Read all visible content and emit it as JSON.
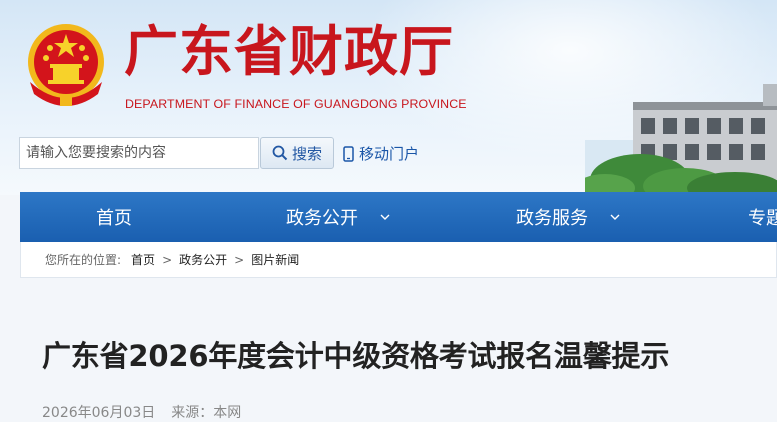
{
  "header": {
    "title_cn": "广东省财政厅",
    "title_en": "DEPARTMENT OF FINANCE OF GUANGDONG PROVINCE",
    "brand_color": "#c8161d"
  },
  "search": {
    "placeholder": "请输入您要搜索的内容",
    "button_label": "搜索",
    "mobile_label": "移动门户"
  },
  "nav": {
    "items": [
      {
        "label": "首页"
      },
      {
        "label": "政务公开"
      },
      {
        "label": "政务服务"
      },
      {
        "label": "专题"
      }
    ],
    "color": "#1f66b5"
  },
  "breadcrumb": {
    "prefix": "您所在的位置:",
    "items": [
      "首页",
      "政务公开",
      "图片新闻"
    ],
    "separator": ">"
  },
  "article": {
    "title": "广东省2026年度会计中级资格考试报名温馨提示",
    "date": "2026年06月03日",
    "source": "来源：本网"
  }
}
